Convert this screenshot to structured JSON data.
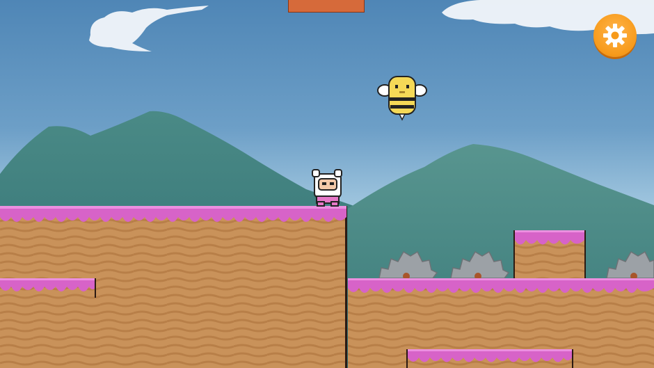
{
  "hud": {
    "boss_health_fraction": 1.0,
    "settings_icon": "gear-icon"
  },
  "characters": {
    "player": {
      "name": "astronaut-hero"
    },
    "enemy": {
      "name": "bee-enemy"
    }
  },
  "colors": {
    "sky_top": "#4f86b6",
    "mountain": "#3f7f80",
    "ground_dirt": "#c9925a",
    "frosting": "#d763c8",
    "saw": "#9ca1a6",
    "health": "#c8562c",
    "settings_button": "#f79a1a"
  }
}
